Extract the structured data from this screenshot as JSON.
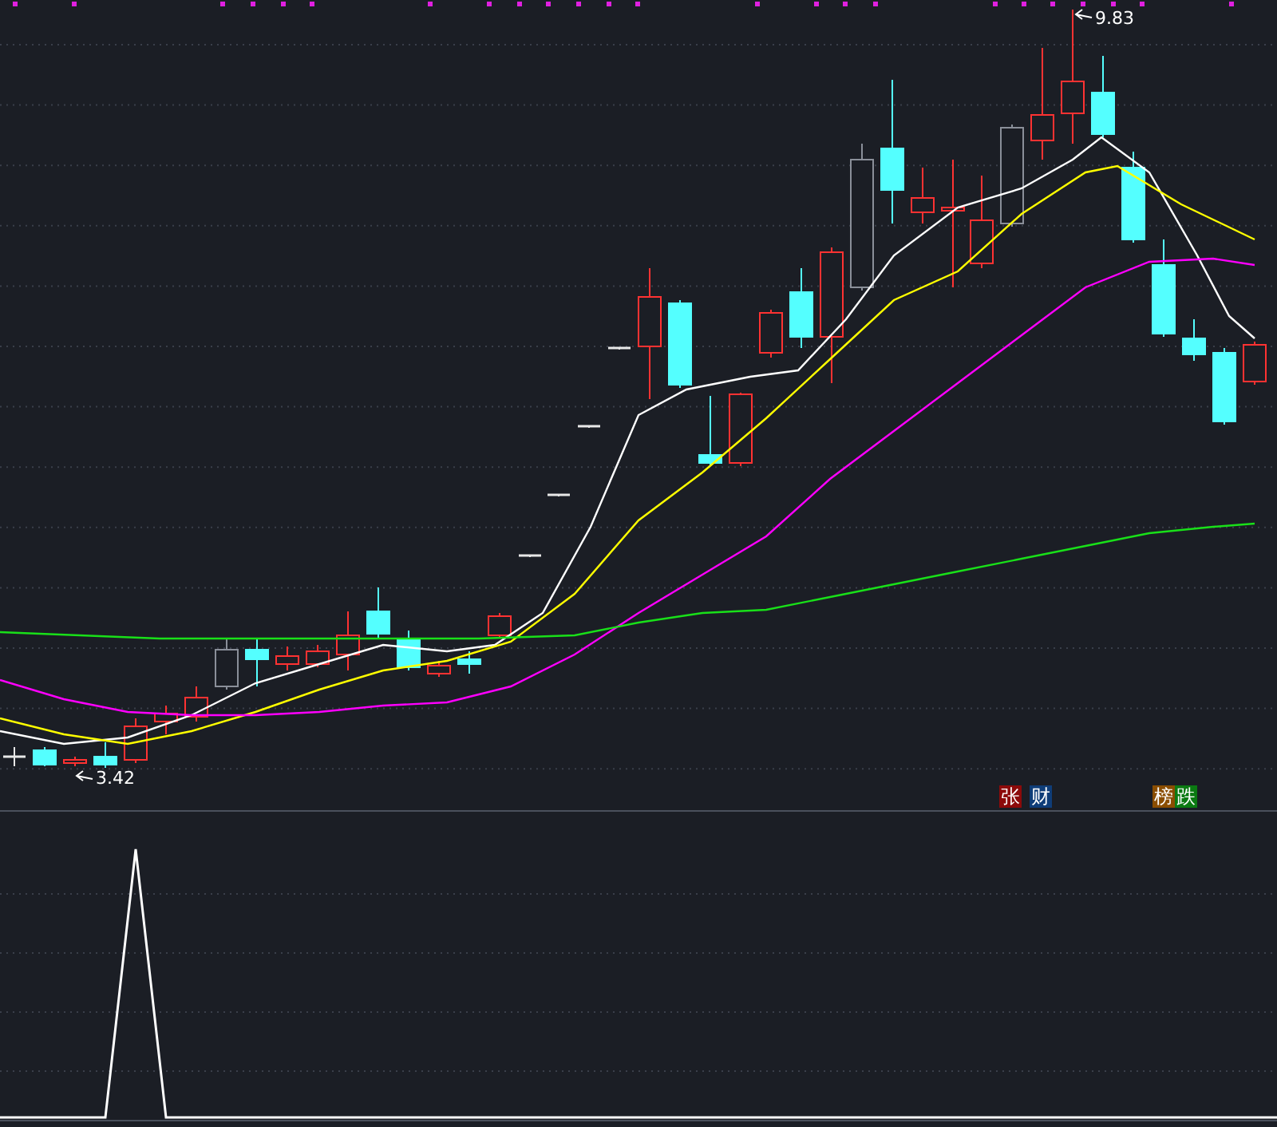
{
  "price_panel": {
    "high_label": "9.83",
    "low_label": "3.42"
  },
  "tags": [
    {
      "text": "张",
      "color": "#8c0a0a"
    },
    {
      "text": "财",
      "color": "#0f3d78"
    },
    {
      "text": "榜",
      "color": "#8a4d00"
    },
    {
      "text": "跌",
      "color": "#0b7a12"
    }
  ]
}
